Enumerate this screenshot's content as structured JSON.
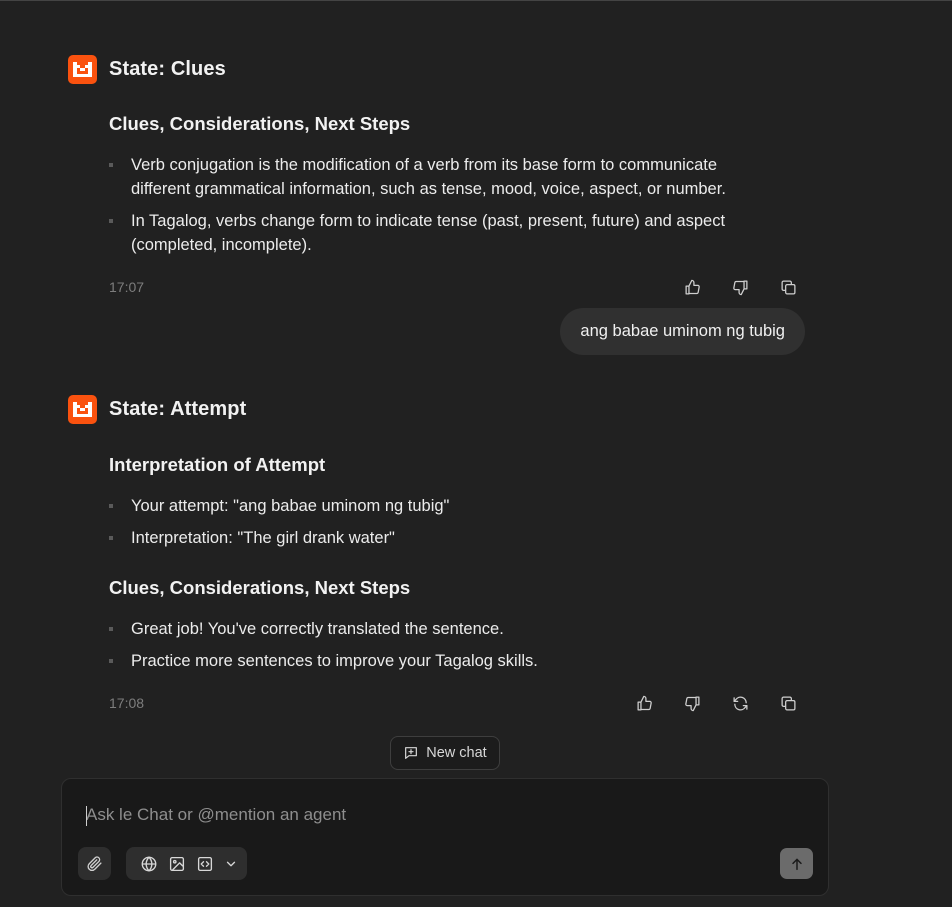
{
  "conversation": {
    "messages": [
      {
        "role": "assistant",
        "state_title": "State: Clues",
        "sections": [
          {
            "title": "Clues, Considerations, Next Steps",
            "bullets": [
              "Verb conjugation is the modification of a verb from its base form to communicate different grammatical information, such as tense, mood, voice, aspect, or number.",
              "In Tagalog, verbs change form to indicate tense (past, present, future) and aspect (completed, incomplete)."
            ]
          }
        ],
        "time": "17:07",
        "actions": [
          "thumbs-up",
          "thumbs-down",
          "copy"
        ]
      },
      {
        "role": "user",
        "text": "ang babae uminom ng tubig"
      },
      {
        "role": "assistant",
        "state_title": "State: Attempt",
        "sections": [
          {
            "title": "Interpretation of Attempt",
            "bullets": [
              "Your attempt: \"ang babae uminom ng tubig\"",
              "Interpretation: \"The girl drank water\""
            ]
          },
          {
            "title": "Clues, Considerations, Next Steps",
            "bullets": [
              "Great job! You've correctly translated the sentence.",
              "Practice more sentences to improve your Tagalog skills."
            ]
          }
        ],
        "time": "17:08",
        "actions": [
          "thumbs-up",
          "thumbs-down",
          "regenerate",
          "copy"
        ]
      }
    ]
  },
  "new_chat": {
    "label": "New chat"
  },
  "composer": {
    "placeholder": "Ask le Chat or @mention an agent",
    "value": "",
    "tools": [
      "globe-icon",
      "image-icon",
      "code-icon",
      "chevron-down-icon"
    ]
  },
  "colors": {
    "background": "#212121",
    "accent": "#fa520f",
    "bubble": "#303030",
    "composer": "#191919"
  }
}
